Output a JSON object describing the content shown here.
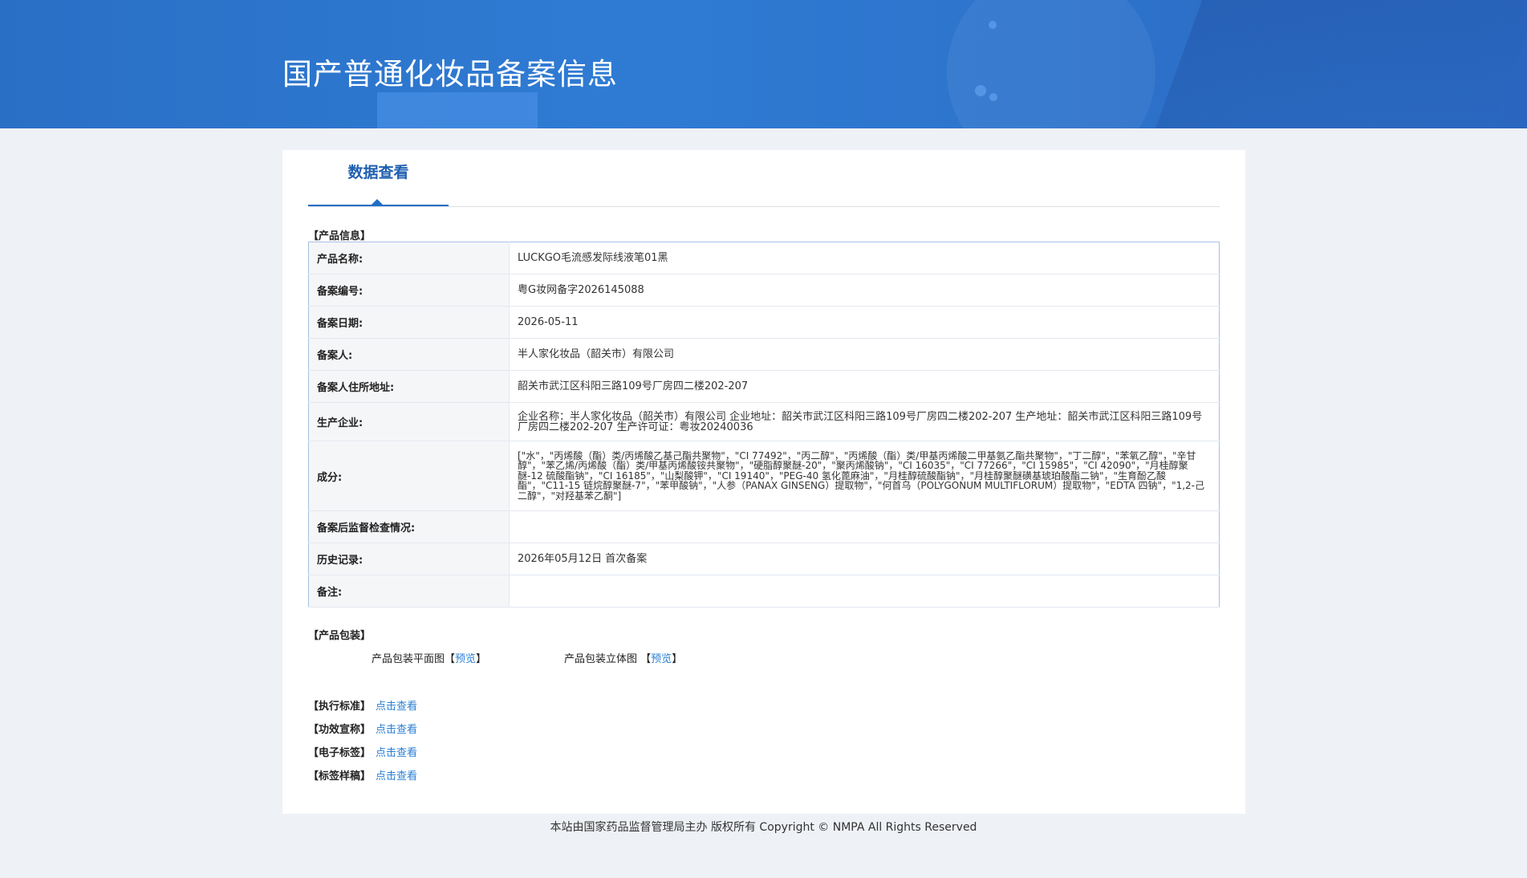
{
  "banner": {
    "title": "国产普通化妆品备案信息"
  },
  "tab": {
    "label": "数据查看"
  },
  "product_info": {
    "section_label": "【产品信息】",
    "rows": [
      {
        "key": "产品名称:",
        "value": "LUCKGO毛流感发际线液笔01黑"
      },
      {
        "key": "备案编号:",
        "value": "粤G妆网备字2026145088"
      },
      {
        "key": "备案日期:",
        "value": "2026-05-11"
      },
      {
        "key": "备案人:",
        "value": "半人家化妆品（韶关市）有限公司"
      },
      {
        "key": "备案人住所地址:",
        "value": "韶关市武江区科阳三路109号厂房四二楼202-207"
      },
      {
        "key": "生产企业:",
        "value": "企业名称：半人家化妆品（韶关市）有限公司 企业地址：韶关市武江区科阳三路109号厂房四二楼202-207 生产地址：韶关市武江区科阳三路109号厂房四二楼202-207 生产许可证：粤妆20240036"
      },
      {
        "key": "成分:",
        "value": "[\"水\"，\"丙烯酸（酯）类/丙烯酸乙基己酯共聚物\"，\"CI 77492\"，\"丙二醇\"，\"丙烯酸（酯）类/甲基丙烯酸二甲基氨乙酯共聚物\"，\"丁二醇\"，\"苯氧乙醇\"，\"辛甘醇\"，\"苯乙烯/丙烯酸（酯）类/甲基丙烯酸铵共聚物\"，\"硬脂醇聚醚-20\"，\"聚丙烯酸钠\"，\"CI 16035\"，\"CI 77266\"，\"CI 15985\"，\"CI 42090\"，\"月桂醇聚醚-12 硫酸酯钠\"，\"CI 16185\"，\"山梨酸钾\"，\"CI 19140\"，\"PEG-40 氢化蓖麻油\"，\"月桂醇硫酸酯钠\"，\"月桂醇聚醚磺基琥珀酸酯二钠\"，\"生育酚乙酸酯\"，\"C11-15 链烷醇聚醚-7\"，\"苯甲酸钠\"，\"人参（PANAX GINSENG）提取物\"，\"何首乌（POLYGONUM MULTIFLORUM）提取物\"，\"EDTA 四钠\"，\"1,2-己二醇\"，\"对羟基苯乙酮\"]"
      },
      {
        "key": "备案后监督检查情况:",
        "value": ""
      },
      {
        "key": "历史记录:",
        "value": "2026年05月12日 首次备案"
      },
      {
        "key": "备注:",
        "value": ""
      }
    ]
  },
  "packaging": {
    "section_label": "【产品包装】",
    "flat": {
      "label": "产品包装平面图",
      "open": "【",
      "link": "预览",
      "close": "】"
    },
    "solid": {
      "label": "产品包装立体图",
      "open": "【",
      "link": "预览",
      "close": "】"
    }
  },
  "docs": [
    {
      "label": "【执行标准】",
      "link": "点击查看"
    },
    {
      "label": "【功效宣称】",
      "link": "点击查看"
    },
    {
      "label": "【电子标签】",
      "link": "点击查看"
    },
    {
      "label": "【标签样稿】",
      "link": "点击查看"
    }
  ],
  "footer": {
    "text": "本站由国家药品监督管理局主办 版权所有 Copyright © NMPA All Rights Reserved"
  },
  "colors": {
    "banner": "#2f7bd3",
    "accent": "#1f6fc5",
    "link": "#2a7fd4",
    "page_bg": "#eef1f5"
  }
}
